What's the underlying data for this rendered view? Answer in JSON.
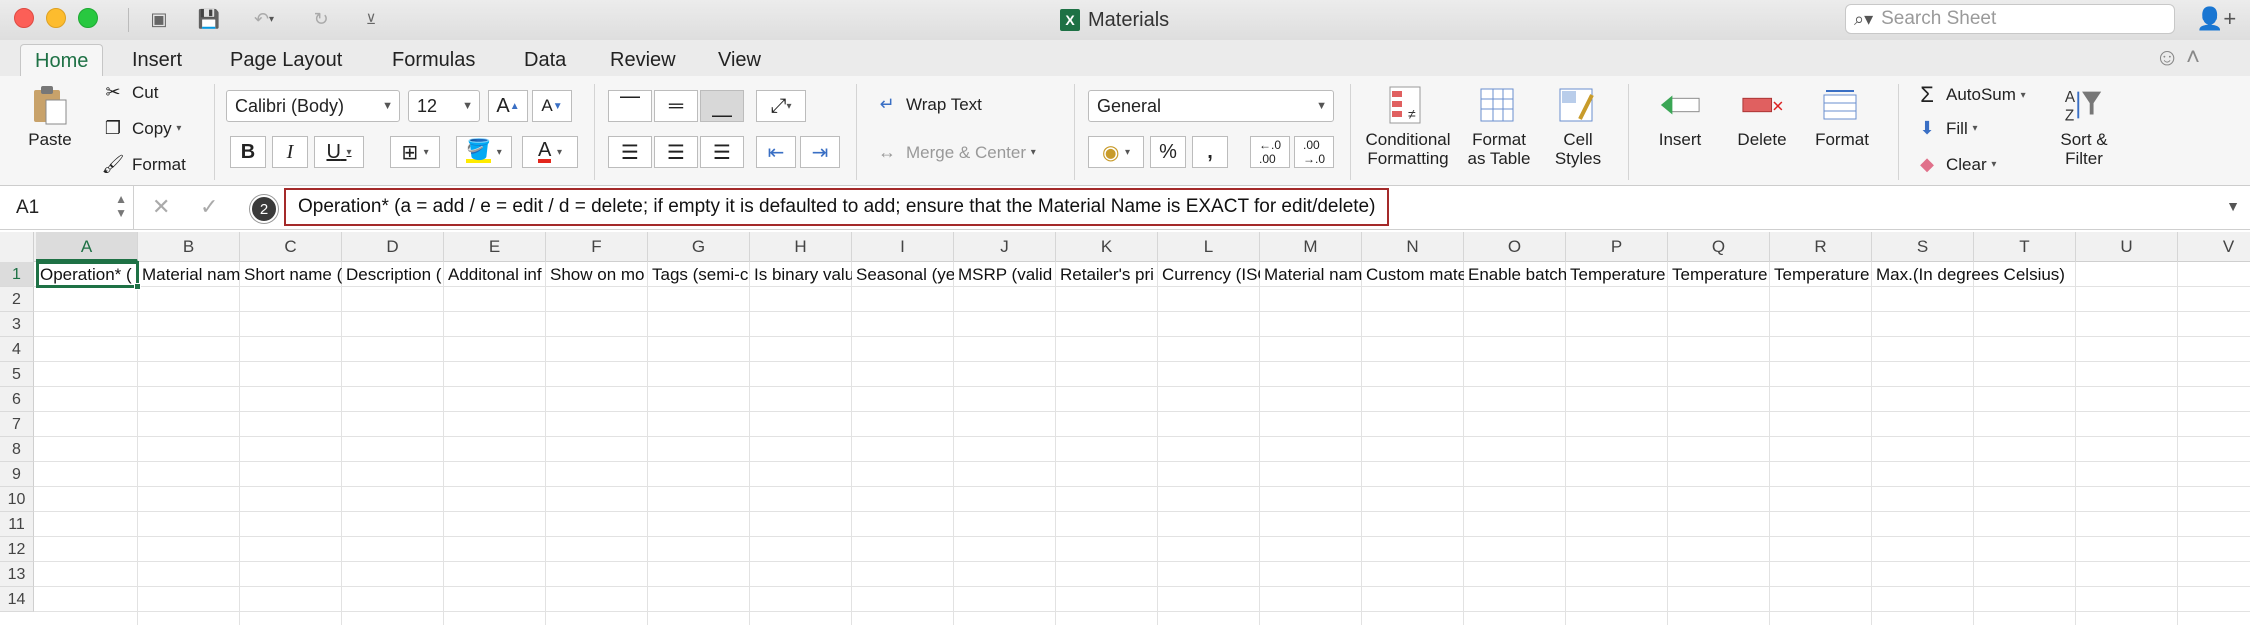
{
  "window": {
    "title": "Materials",
    "search_placeholder": "Search Sheet"
  },
  "tabs": [
    "Home",
    "Insert",
    "Page Layout",
    "Formulas",
    "Data",
    "Review",
    "View"
  ],
  "ribbon": {
    "clipboard": {
      "paste": "Paste",
      "cut": "Cut",
      "copy": "Copy",
      "format": "Format"
    },
    "font": {
      "name": "Calibri (Body)",
      "size": "12",
      "bold": "B",
      "italic": "I",
      "underline": "U",
      "grow": "A",
      "shrink": "A"
    },
    "alignment": {
      "wrap_text": "Wrap Text",
      "merge_center": "Merge & Center"
    },
    "number": {
      "format": "General",
      "percent": "%",
      "comma": ","
    },
    "styles": {
      "conditional_formatting": "Conditional Formatting",
      "format_as_table": "Format as Table",
      "cell_styles": "Cell Styles"
    },
    "cells": {
      "insert": "Insert",
      "delete": "Delete",
      "format": "Format"
    },
    "editing": {
      "autosum": "AutoSum",
      "fill": "Fill",
      "clear": "Clear",
      "sort_filter": "Sort & Filter"
    }
  },
  "formula_bar": {
    "cell_ref": "A1",
    "step_number": "2",
    "content": "Operation* (a = add / e = edit / d = delete; if empty it is defaulted to add; ensure that the Material Name is EXACT for edit/delete)"
  },
  "sheet": {
    "columns": [
      "A",
      "B",
      "C",
      "D",
      "E",
      "F",
      "G",
      "H",
      "I",
      "J",
      "K",
      "L",
      "M",
      "N",
      "O",
      "P",
      "Q",
      "R",
      "S",
      "T",
      "U",
      "V"
    ],
    "rows": [
      "1",
      "2",
      "3",
      "4",
      "5",
      "6",
      "7",
      "8",
      "9",
      "10",
      "11",
      "12",
      "13",
      "14"
    ],
    "row1": [
      "Operation* (",
      "Material nam",
      "Short name (",
      "Description (",
      "Additonal inf",
      "Show on mo",
      "Tags (semi-c",
      "Is binary valu",
      "Seasonal (ye",
      "MSRP (valid",
      "Retailer's pri",
      "Currency (ISO",
      "Material nam",
      "Custom mate",
      "Enable batch",
      "Temperature",
      "Temperature",
      "Temperature",
      "Max.(In degrees Celsius)"
    ]
  },
  "colors": {
    "accent": "#1e7145",
    "highlight_border": "#a42a2a"
  }
}
